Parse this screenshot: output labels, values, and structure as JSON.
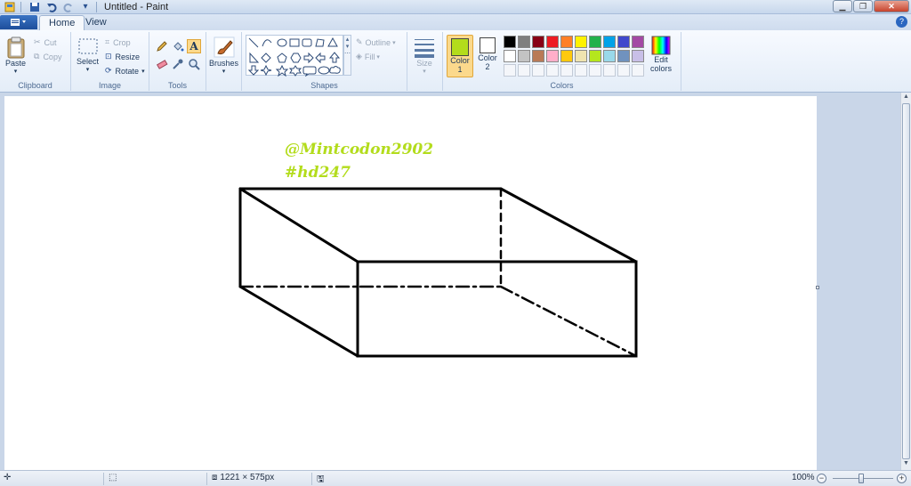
{
  "window": {
    "title": "Untitled - Paint"
  },
  "tabs": [
    {
      "label": "Home"
    },
    {
      "label": "View"
    }
  ],
  "ribbon": {
    "clipboard": {
      "label": "Clipboard",
      "paste": "Paste",
      "cut": "Cut",
      "copy": "Copy"
    },
    "image": {
      "label": "Image",
      "select": "Select",
      "crop": "Crop",
      "resize": "Resize",
      "rotate": "Rotate"
    },
    "tools": {
      "label": "Tools"
    },
    "brushes": {
      "label": "Brushes"
    },
    "shapes": {
      "label": "Shapes",
      "outline": "Outline",
      "fill": "Fill"
    },
    "size": {
      "label": "Size"
    },
    "colors": {
      "label": "Colors",
      "color1": "Color",
      "color1_num": "1",
      "color2": "Color",
      "color2_num": "2",
      "edit_colors_line1": "Edit",
      "edit_colors_line2": "colors",
      "color1_value": "#b3dc1c",
      "color2_value": "#ffffff",
      "palette_row1": [
        "#000000",
        "#7f7f7f",
        "#880015",
        "#ed1c24",
        "#ff7f27",
        "#fff200",
        "#22b14c",
        "#00a2e8",
        "#3f48cc",
        "#a349a4"
      ],
      "palette_row2": [
        "#ffffff",
        "#c3c3c3",
        "#b97a57",
        "#ffaec9",
        "#ffc90e",
        "#efe4b0",
        "#b5e61d",
        "#99d9ea",
        "#7092be",
        "#c8bfe7"
      ]
    }
  },
  "canvas": {
    "text_line1": "@Mintcodon2902",
    "text_line2": "#hd247",
    "text_color": "#b3dc1c"
  },
  "statusbar": {
    "dimensions": "1221 × 575px",
    "zoom": "100%"
  }
}
